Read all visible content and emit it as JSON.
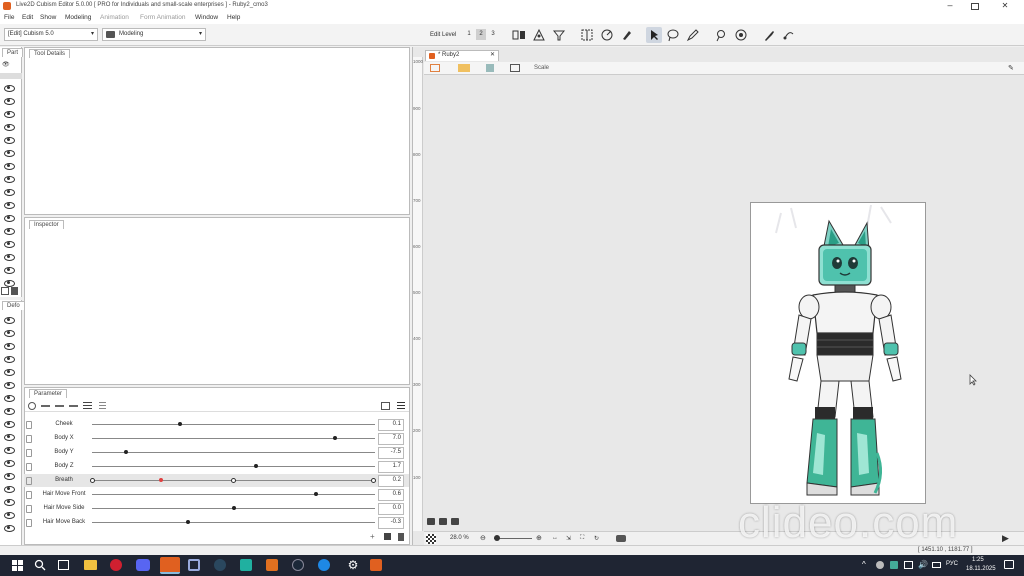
{
  "window": {
    "title": "Live2D Cubism Editor 5.0.00  [ PRO for Individuals and small-scale enterprises ]  -  Ruby2_cmo3"
  },
  "menu": [
    "File",
    "Edit",
    "Show",
    "Modeling",
    "Animation",
    "Form Animation",
    "Window",
    "Help"
  ],
  "toolbar": {
    "model_select": "[Edit] Cubism 5.0",
    "mode_select": "Modeling",
    "edit_level_label": "Edit Level",
    "edit_levels": [
      "1",
      "2",
      "3"
    ]
  },
  "panels": {
    "part_tab": "Part",
    "tool_details_tab": "Tool Details",
    "deformer_tab": "Defo",
    "inspector_tab": "Inspector",
    "parameter_tab": "Parameter"
  },
  "parameters": [
    {
      "name": "Cheek",
      "value": "0.1",
      "pos": 0.31
    },
    {
      "name": "Body X",
      "value": "7.0",
      "pos": 0.86
    },
    {
      "name": "Body Y",
      "value": "-7.5",
      "pos": 0.12
    },
    {
      "name": "Body Z",
      "value": "1.7",
      "pos": 0.58
    },
    {
      "name": "Breath",
      "value": "0.2",
      "pos": 0.5
    },
    {
      "name": "Hair Move Front",
      "value": "0.6",
      "pos": 0.79
    },
    {
      "name": "Hair Move Side",
      "value": "0.0",
      "pos": 0.5
    },
    {
      "name": "Hair Move Back",
      "value": "-0.3",
      "pos": 0.34
    }
  ],
  "viewport": {
    "doc_tab": "* Ruby2",
    "scale_label": "Scale",
    "ruler_ticks": [
      "1000",
      "900",
      "800",
      "700",
      "600",
      "500",
      "400",
      "300",
      "200",
      "100"
    ],
    "zoom": "28.0 %",
    "status_coords": "[ 1451.10 , 1181.77 ]"
  },
  "watermark": "clideo.com",
  "taskbar": {
    "lang": "РУС",
    "time": "1:25",
    "date": "18.11.2025"
  }
}
